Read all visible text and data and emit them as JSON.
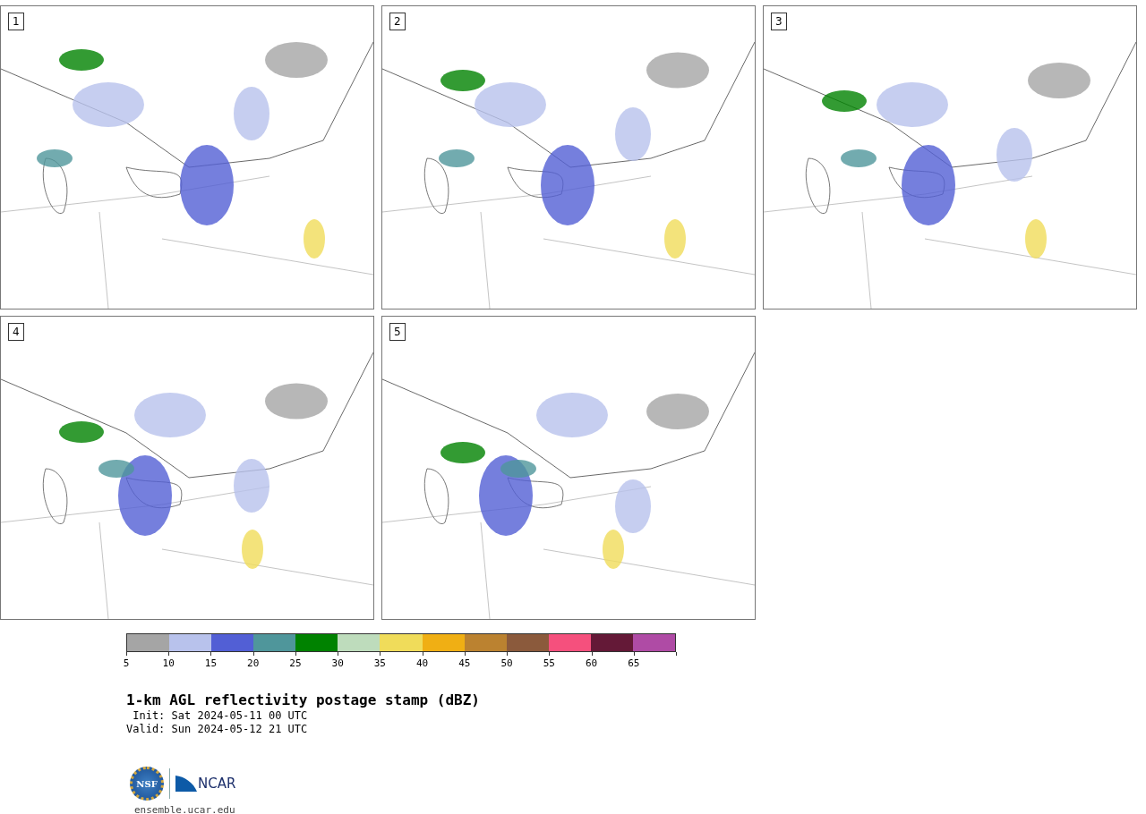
{
  "panels": [
    {
      "label": "1"
    },
    {
      "label": "2"
    },
    {
      "label": "3"
    },
    {
      "label": "4"
    },
    {
      "label": "5"
    }
  ],
  "colorbar": {
    "bins": [
      {
        "label": "5",
        "color": "#a5a5a5"
      },
      {
        "label": "10",
        "color": "#b8c2ec"
      },
      {
        "label": "15",
        "color": "#525fd5"
      },
      {
        "label": "20",
        "color": "#4f969b"
      },
      {
        "label": "25",
        "color": "#008200"
      },
      {
        "label": "30",
        "color": "#bedcbc"
      },
      {
        "label": "35",
        "color": "#f0dc5a"
      },
      {
        "label": "40",
        "color": "#f0af14"
      },
      {
        "label": "45",
        "color": "#bb8230"
      },
      {
        "label": "50",
        "color": "#8b5a3c"
      },
      {
        "label": "55",
        "color": "#f5507d"
      },
      {
        "label": "60",
        "color": "#641937"
      },
      {
        "label": "65",
        "color": "#af4ba5"
      }
    ]
  },
  "title": "1-km AGL reflectivity postage stamp (dBZ)",
  "init": "Init: Sat 2024-05-11 00 UTC",
  "valid": "Valid: Sun 2024-05-12 21 UTC",
  "logo": {
    "left": "NSF",
    "right": "NCAR"
  },
  "site": "ensemble.ucar.edu"
}
